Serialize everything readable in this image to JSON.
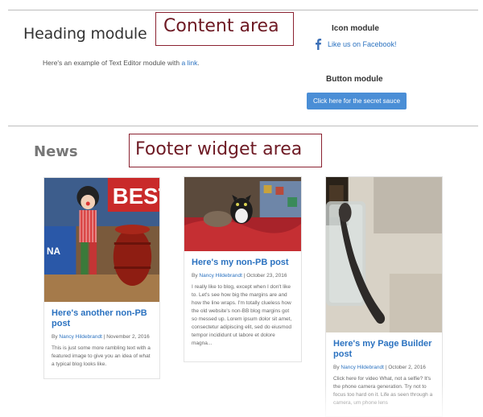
{
  "content_module": {
    "heading": "Heading module",
    "content_area_label": "Content area",
    "text_editor": {
      "prefix": "Here's an example of Text Editor module with",
      "link_text": "a link",
      "suffix": "."
    },
    "icon_module": {
      "title": "Icon module",
      "icon": "facebook-icon",
      "link_text": "Like us on Facebook!"
    },
    "button_module": {
      "title": "Button module",
      "button_label": "Click here for the secret sauce"
    }
  },
  "footer": {
    "news_title": "News",
    "widget_area_label": "Footer widget area",
    "posts": [
      {
        "title": "Here's another non-PB post",
        "meta_prefix": "By",
        "author": "Nancy Hildebrandt",
        "date": "November 2, 2016",
        "excerpt": "This is just some more rambling text with a featured image to give you an idea of what a typical blog looks like.",
        "image": "clown-with-barrel-photo"
      },
      {
        "title": "Here's my non-PB post",
        "meta_prefix": "By",
        "author": "Nancy Hildebrandt",
        "date": "October 23, 2016",
        "excerpt": "I really like to blog, except when I don't like to. Let's see how big the margins are and how the line wraps. I'm totally clueless how the old website's non-BB blog margins got so messed up. Lorem ipsum dolor sit amet, consectetur adipiscing elit, sed do eiusmod tempor incididunt ut labore et dolore magna...",
        "image": "cats-on-bed-photo"
      },
      {
        "title": "Here's my Page Builder post",
        "meta_prefix": "By",
        "author": "Nancy Hildebrandt",
        "date": "October 2, 2016",
        "excerpt": "Click here for video What, not a selfie? It's the phone camera generation. Try not to focus too hard on it. Life as seen through a camera, um phone lens",
        "image": "bent-spoon-in-jar-photo"
      }
    ]
  },
  "colors": {
    "link": "#2b72c0",
    "button": "#4a8ed6",
    "label_border": "#8b2231",
    "label_text": "#6e1a24"
  }
}
